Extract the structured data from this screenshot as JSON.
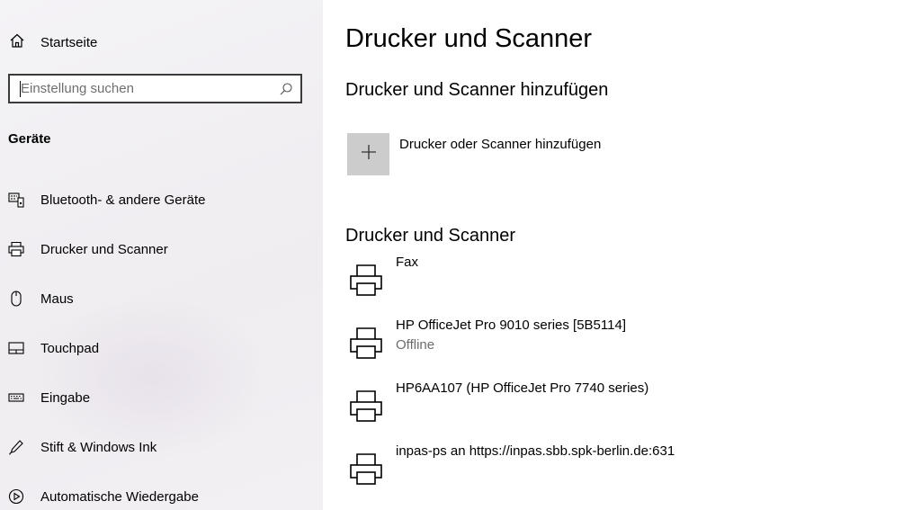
{
  "sidebar": {
    "home_label": "Startseite",
    "search": {
      "placeholder": "Einstellung suchen",
      "value": ""
    },
    "section_title": "Geräte",
    "items": [
      {
        "label": "Bluetooth- & andere Geräte",
        "icon": "bluetooth-devices-icon"
      },
      {
        "label": "Drucker und Scanner",
        "icon": "printer-icon"
      },
      {
        "label": "Maus",
        "icon": "mouse-icon"
      },
      {
        "label": "Touchpad",
        "icon": "touchpad-icon"
      },
      {
        "label": "Eingabe",
        "icon": "keyboard-icon"
      },
      {
        "label": "Stift & Windows Ink",
        "icon": "pen-icon"
      },
      {
        "label": "Automatische Wiedergabe",
        "icon": "autoplay-icon"
      }
    ]
  },
  "main": {
    "title": "Drucker und Scanner",
    "add_section": {
      "heading": "Drucker und Scanner hinzufügen",
      "button_label": "Drucker oder Scanner hinzufügen"
    },
    "list_section": {
      "heading": "Drucker und Scanner",
      "printers": [
        {
          "name": "Fax",
          "status": ""
        },
        {
          "name": "HP OfficeJet Pro 9010 series [5B5114]",
          "status": "Offline"
        },
        {
          "name": "HP6AA107 (HP OfficeJet Pro 7740 series)",
          "status": ""
        },
        {
          "name": "inpas-ps an https://inpas.sbb.spk-berlin.de:631",
          "status": ""
        }
      ]
    }
  },
  "colors": {
    "add_button_bg": "#cccccc",
    "status_text": "#6d6d6d"
  }
}
